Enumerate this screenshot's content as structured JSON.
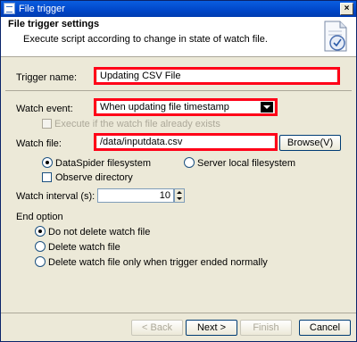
{
  "window": {
    "title": "File trigger"
  },
  "header": {
    "title": "File trigger settings",
    "description": "Execute script according to change in state of watch file."
  },
  "trigger_name": {
    "label": "Trigger name:",
    "value": "Updating CSV File"
  },
  "watch_event": {
    "label": "Watch event:",
    "selected": "When updating file timestamp",
    "execute_if_exists_label": "Execute if the watch file already exists"
  },
  "watch_file": {
    "label": "Watch file:",
    "value": "/data/inputdata.csv",
    "browse_label": "Browse(V)",
    "filesystem_options": [
      "DataSpider filesystem",
      "Server local filesystem"
    ],
    "selected_filesystem": "DataSpider filesystem",
    "observe_directory_label": "Observe directory"
  },
  "watch_interval": {
    "label": "Watch interval (s):",
    "value": "10"
  },
  "end_option": {
    "label": "End option",
    "options": [
      "Do not delete watch file",
      "Delete watch file",
      "Delete watch file only when trigger ended normally"
    ],
    "selected": "Do not delete watch file"
  },
  "footer": {
    "back_label": "< Back",
    "next_label": "Next >",
    "finish_label": "Finish",
    "cancel_label": "Cancel"
  },
  "colors": {
    "highlight": "#ff0018",
    "titlebar": "#0a5ee0"
  }
}
